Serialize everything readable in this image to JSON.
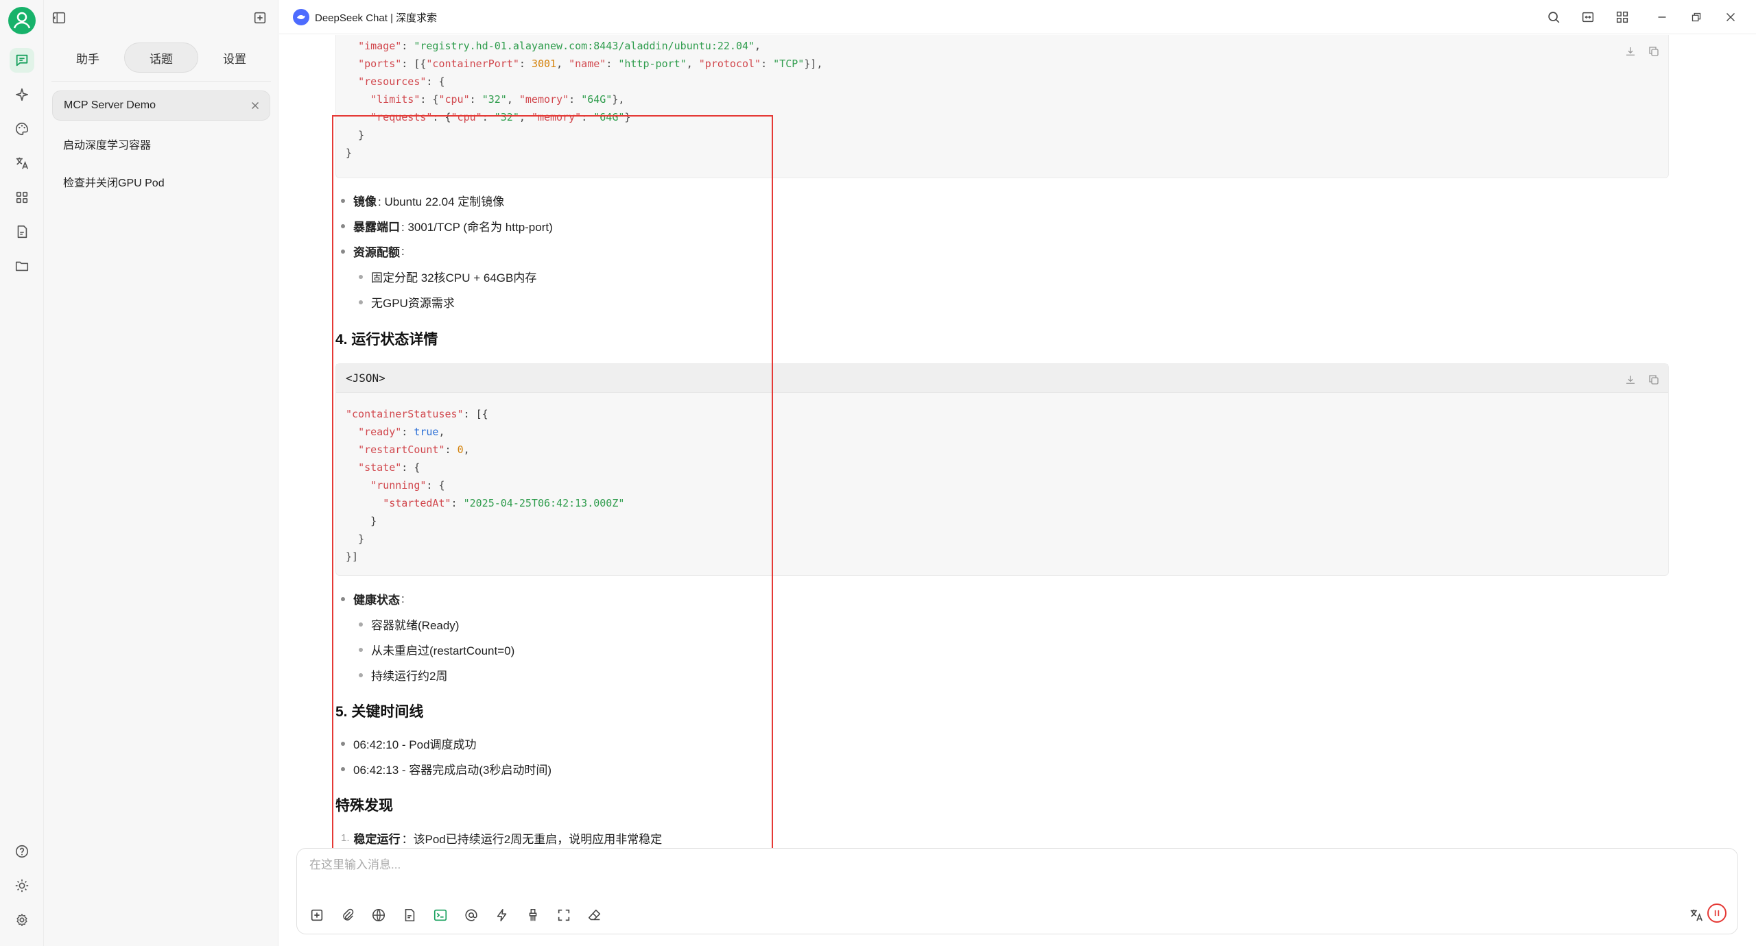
{
  "colors": {
    "accent": "#17a05d",
    "brand": "#4d6bfe",
    "highlight_box": "#e53935"
  },
  "header": {
    "title": "DeepSeek Chat | 深度求索"
  },
  "sidebar": {
    "tabs": [
      "助手",
      "话题",
      "设置"
    ],
    "active_tab": "话题",
    "topics": [
      "MCP Server Demo",
      "启动深度学习容器",
      "检查并关闭GPU Pod"
    ]
  },
  "message": {
    "code1": {
      "lines": [
        [
          "  ",
          "\"image\"",
          ": ",
          "\"registry.hd-01.alayanew.com:8443/aladdin/ubuntu:22.04\"",
          ","
        ],
        [
          "  ",
          "\"ports\"",
          ": [{",
          "\"containerPort\"",
          ": ",
          "3001",
          ", ",
          "\"name\"",
          ": ",
          "\"http-port\"",
          ", ",
          "\"protocol\"",
          ": ",
          "\"TCP\"",
          "}],"
        ],
        [
          "  ",
          "\"resources\"",
          ": {"
        ],
        [
          "    ",
          "\"limits\"",
          ": {",
          "\"cpu\"",
          ": ",
          "\"32\"",
          ", ",
          "\"memory\"",
          ": ",
          "\"64G\"",
          "},"
        ],
        [
          "    ",
          "\"requests\"",
          ": {",
          "\"cpu\"",
          ": ",
          "\"32\"",
          ", ",
          "\"memory\"",
          ": ",
          "\"64G\"",
          "}"
        ],
        [
          "  }"
        ],
        [
          "}"
        ]
      ]
    },
    "bullets1": [
      {
        "bold": "镜像",
        "text": ": Ubuntu 22.04 定制镜像"
      },
      {
        "bold": "暴露端口",
        "text": ": 3001/TCP (命名为 http-port)"
      },
      {
        "bold": "资源配额",
        "text": ":"
      }
    ],
    "sub_bullets1": [
      "固定分配 32核CPU + 64GB内存",
      "无GPU资源需求"
    ],
    "heading4": "4. 运行状态详情",
    "code2": {
      "lang": "<JSON>",
      "lines": [
        [
          "",
          "\"containerStatuses\"",
          ": [{"
        ],
        [
          "  ",
          "\"ready\"",
          ": ",
          "true",
          ","
        ],
        [
          "  ",
          "\"restartCount\"",
          ": ",
          "0",
          ","
        ],
        [
          "  ",
          "\"state\"",
          ": {"
        ],
        [
          "    ",
          "\"running\"",
          ": {"
        ],
        [
          "      ",
          "\"startedAt\"",
          ": ",
          "\"2025-04-25T06:42:13.000Z\""
        ],
        [
          "    }"
        ],
        [
          "  }"
        ],
        [
          "}]"
        ]
      ]
    },
    "bullets2": [
      {
        "bold": "健康状态",
        "text": ":"
      }
    ],
    "sub_bullets2": [
      "容器就绪(Ready)",
      "从未重启过(restartCount=0)",
      "持续运行约2周"
    ],
    "heading5": "5. 关键时间线",
    "timeline": [
      "06:42:10 - Pod调度成功",
      "06:42:13 - 容器完成启动(3秒启动时间)"
    ],
    "heading_special": "特殊发现",
    "special": [
      {
        "num": "1.",
        "bold": "稳定运行",
        "text": "：该Pod已持续运行2周无重启，说明应用非常稳定"
      }
    ]
  },
  "composer": {
    "placeholder": "在这里输入消息..."
  }
}
